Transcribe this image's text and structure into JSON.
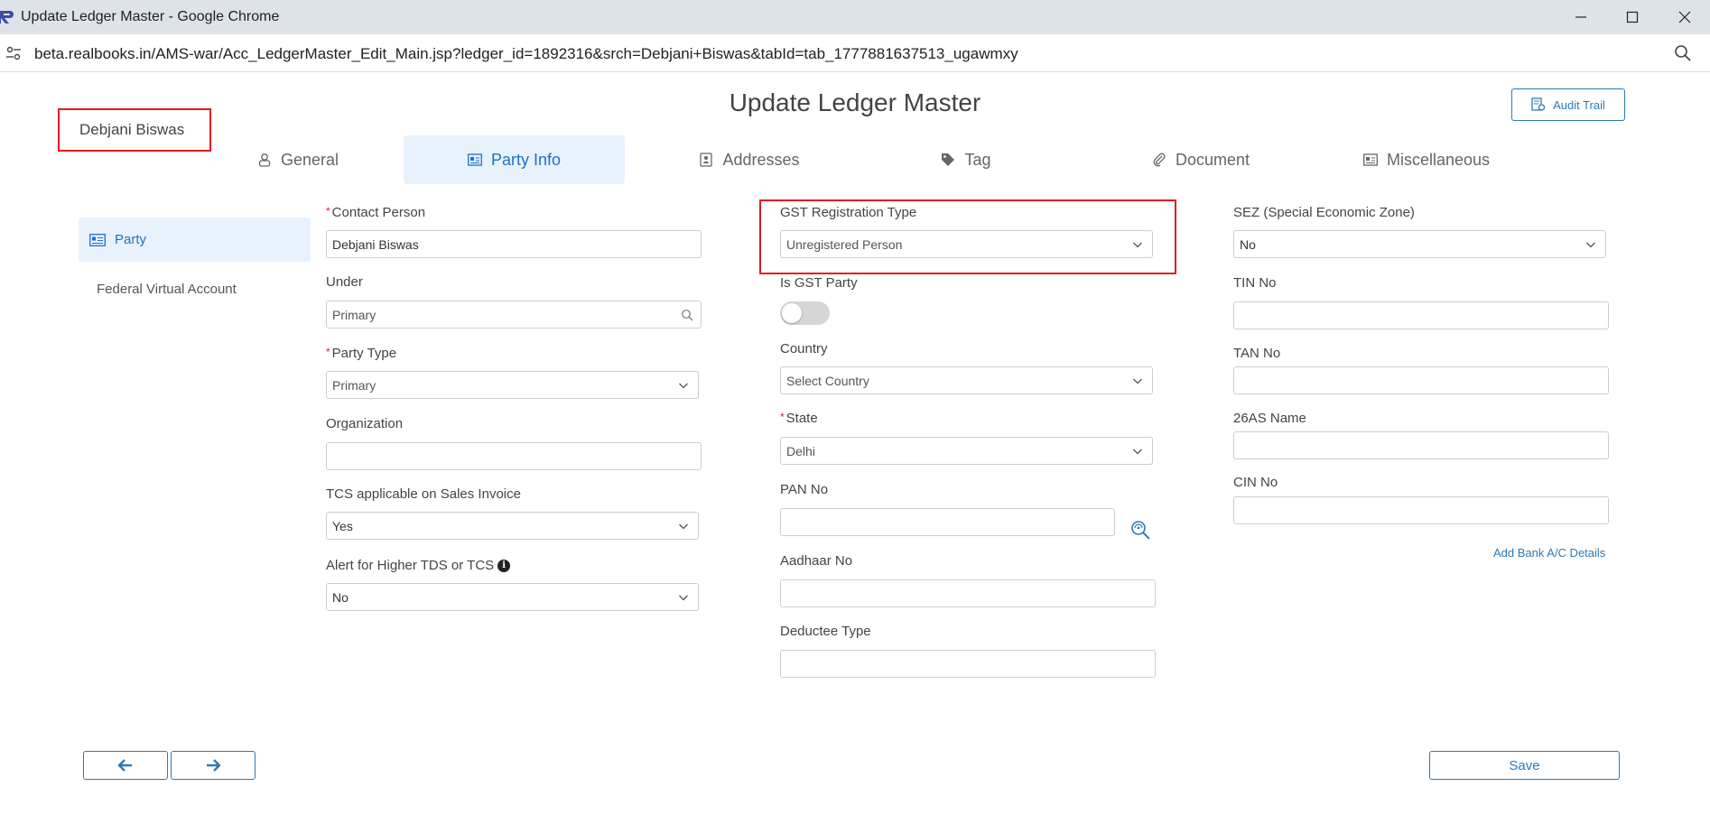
{
  "window": {
    "title": "Update Ledger Master - Google Chrome",
    "url": "beta.realbooks.in/AMS-war/Acc_LedgerMaster_Edit_Main.jsp?ledger_id=1892316&srch=Debjani+Biswas&tabId=tab_1777881637513_ugawmxy"
  },
  "header": {
    "page_title": "Update Ledger Master",
    "party_name": "Debjani Biswas",
    "audit_trail_label": "Audit Trail"
  },
  "tabs": [
    {
      "label": "General",
      "icon": "user-icon"
    },
    {
      "label": "Party Info",
      "icon": "id-card-icon"
    },
    {
      "label": "Addresses",
      "icon": "contact-book-icon"
    },
    {
      "label": "Tag",
      "icon": "tag-icon"
    },
    {
      "label": "Document",
      "icon": "paperclip-icon"
    },
    {
      "label": "Miscellaneous",
      "icon": "id-card-icon"
    }
  ],
  "sidebar": {
    "items": [
      {
        "label": "Party",
        "active": true
      },
      {
        "label": "Federal Virtual Account",
        "active": false
      }
    ]
  },
  "form": {
    "contact_person": {
      "label": "Contact Person",
      "value": "Debjani Biswas"
    },
    "under": {
      "label": "Under",
      "value": "Primary"
    },
    "party_type": {
      "label": "Party Type",
      "value": "Primary"
    },
    "organization": {
      "label": "Organization",
      "value": ""
    },
    "tcs_applicable": {
      "label": "TCS applicable on Sales Invoice",
      "value": "Yes"
    },
    "alert_higher_tds": {
      "label": "Alert for Higher TDS or TCS",
      "value": "No"
    },
    "gst_registration_type": {
      "label": "GST Registration Type",
      "value": "Unregistered Person"
    },
    "is_gst_party": {
      "label": "Is GST Party",
      "value": "off"
    },
    "country": {
      "label": "Country",
      "value": "Select Country"
    },
    "state": {
      "label": "State",
      "value": "Delhi"
    },
    "pan_no": {
      "label": "PAN No",
      "value": ""
    },
    "aadhaar_no": {
      "label": "Aadhaar No",
      "value": ""
    },
    "deductee_type": {
      "label": "Deductee Type",
      "value": ""
    },
    "sez": {
      "label": "SEZ (Special Economic Zone)",
      "value": "No"
    },
    "tin_no": {
      "label": "TIN No",
      "value": ""
    },
    "tan_no": {
      "label": "TAN No",
      "value": ""
    },
    "name_26as": {
      "label": "26AS Name",
      "value": ""
    },
    "cin_no": {
      "label": "CIN No",
      "value": ""
    },
    "add_bank_link": "Add Bank A/C Details"
  },
  "footer": {
    "save_label": "Save"
  },
  "colors": {
    "accent": "#2c7ab8",
    "active_tab_bg": "#e8f2fc",
    "highlight": "#e31b23"
  }
}
